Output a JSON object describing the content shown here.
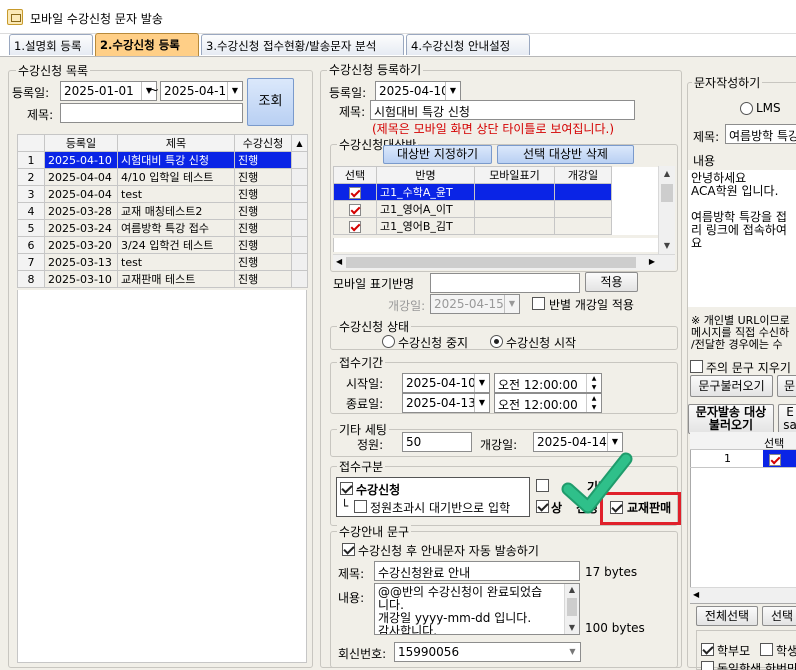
{
  "window": {
    "title": "모바일 수강신청 문자 발송"
  },
  "tabs": [
    {
      "label": "1.설명회 등록"
    },
    {
      "label": "2.수강신청 등록"
    },
    {
      "label": "3.수강신청 접수현황/발송문자 분석"
    },
    {
      "label": "4.수강신청 안내설정"
    }
  ],
  "left": {
    "group_title": "수강신청 목록",
    "date_label": "등록일:",
    "date_from": "2025-01-01",
    "tilde": "~",
    "date_to": "2025-04-11",
    "title_label": "제목:",
    "title_value": "",
    "search_button": "조회",
    "columns": [
      "등록일",
      "제목",
      "수강신청"
    ],
    "rows": [
      {
        "no": "1",
        "date": "2025-04-10",
        "title": "시험대비 특강 신청",
        "status": "진행"
      },
      {
        "no": "2",
        "date": "2025-04-04",
        "title": "4/10 입학일 테스트",
        "status": "진행"
      },
      {
        "no": "3",
        "date": "2025-04-04",
        "title": "test",
        "status": "진행"
      },
      {
        "no": "4",
        "date": "2025-03-28",
        "title": "교재 매칭테스트2",
        "status": "진행"
      },
      {
        "no": "5",
        "date": "2025-03-24",
        "title": "여름방학 특강 접수",
        "status": "진행"
      },
      {
        "no": "6",
        "date": "2025-03-20",
        "title": "3/24 입학건 테스트",
        "status": "진행"
      },
      {
        "no": "7",
        "date": "2025-03-13",
        "title": "test",
        "status": "진행"
      },
      {
        "no": "8",
        "date": "2025-03-10",
        "title": "교재판매 테스트",
        "status": "진행"
      }
    ]
  },
  "mid": {
    "group_title": "수강신청 등록하기",
    "date_label": "등록일:",
    "date_value": "2025-04-10",
    "title_label": "제목:",
    "title_value": "시험대비 특강 신청",
    "title_note": "(제목은 모바일 화면 상단 타이틀로 보여집니다.)",
    "target_group": "수강신청대상반",
    "assign_button": "대상반 지정하기",
    "delete_button": "선택 대상반 삭제",
    "class_columns": [
      "선택",
      "반명",
      "모바일표기",
      "개강일"
    ],
    "class_rows": [
      {
        "name": "고1_수학A_윤T",
        "mobile": "",
        "open": ""
      },
      {
        "name": "고1_영어A_이T",
        "mobile": "",
        "open": ""
      },
      {
        "name": "고1_영어B_김T",
        "mobile": "",
        "open": ""
      }
    ],
    "mobile_label": "모바일 표기반명",
    "mobile_value": "",
    "apply_button": "적용",
    "open_date_label": "개강일:",
    "open_date_value": "2025-04-15",
    "per_class_label": "반별 개강일 적용",
    "status_group": "수강신청 상태",
    "status_stop": "수강신청 중지",
    "status_start": "수강신청 시작",
    "period_group": "접수기간",
    "start_label": "시작일:",
    "start_date": "2025-04-10",
    "start_time": "오전 12:00:00",
    "end_label": "종료일:",
    "end_date": "2025-04-13",
    "end_time": "오전 12:00:00",
    "etc_group": "기타 세팅",
    "capacity_label": "정원:",
    "capacity_value": "50",
    "etc_open_label": "개강일:",
    "etc_open_value": "2025-04-14",
    "kind_group": "접수구분",
    "kind_main": "수강신청",
    "kind_waiting_prefix": "└",
    "kind_waiting": "정원초과시 대기반으로 입학",
    "kind_partial_a": "기반",
    "kind_partial_b": "상",
    "kind_partial_c": "신청",
    "kind_textbook": "교재판매",
    "guide_group": "수강안내 문구",
    "guide_auto": "수강신청 후 안내문자 자동 발송하기",
    "guide_title_label": "제목:",
    "guide_title_value": "수강신청완료 안내",
    "guide_title_bytes": "17 bytes",
    "guide_content_label": "내용:",
    "guide_content": "@@반의 수강신청이 완료되었습\n니다.\n개강일 yyyy-mm-dd 입니다.\n감사합니다.",
    "guide_content_bytes": "100 bytes",
    "callback_label": "회신번호:",
    "callback_value": "15990056"
  },
  "right": {
    "group_title": "문자작성하기",
    "lms": "LMS",
    "title_label": "제목:",
    "title_value": "여름방학 특강",
    "content_label": "내용",
    "content": "안녕하세요\nACA학원 입니다.\n\n여름방학 특강을 접\n리 링크에 접속하여\n요",
    "notice": "※ 개인별 URL이므로\n메시지를 직접 수신하\n/전달한 경우에는 수",
    "clear_label": "주의 문구 지우기",
    "load_button": "문구불러오기",
    "load_button2": "문",
    "target_button": "문자발송 대상\n불러오기",
    "target_button2_a": "E",
    "target_button2_b": "sa",
    "target_col": "선택",
    "target_row_no": "1",
    "select_all": "전체선택",
    "select_btn": "선택",
    "parent_label": "학부모",
    "student_label": "학생",
    "sibling_label": "동일학생 한번만"
  },
  "colors": {
    "selected_row": "#0a24e6",
    "active_tab": "#ffcf87",
    "highlight_box": "#e0202a",
    "check_mark": "#22b07a",
    "note_red": "#d40000"
  }
}
